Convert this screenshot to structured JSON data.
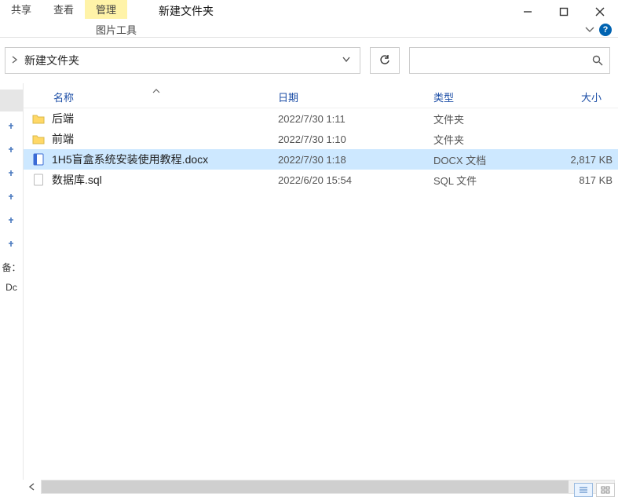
{
  "ribbon": {
    "tab_share": "共享",
    "tab_view": "查看",
    "tab_manage": "管理",
    "sub_image_tools": "图片工具"
  },
  "window": {
    "title": "新建文件夹"
  },
  "address": {
    "crumb": "新建文件夹"
  },
  "columns": {
    "name": "名称",
    "date": "日期",
    "type": "类型",
    "size": "大小"
  },
  "navpane": {
    "label_backup": "备：",
    "label_doc": "Dc"
  },
  "rows": [
    {
      "name": "后端",
      "date": "2022/7/30 1:11",
      "type": "文件夹",
      "size": "",
      "icon": "folder",
      "selected": false
    },
    {
      "name": "前端",
      "date": "2022/7/30 1:10",
      "type": "文件夹",
      "size": "",
      "icon": "folder",
      "selected": false
    },
    {
      "name": "1H5盲盒系统安装使用教程.docx",
      "date": "2022/7/30 1:18",
      "type": "DOCX 文档",
      "size": "2,817 KB",
      "icon": "docx",
      "selected": true
    },
    {
      "name": "数据库.sql",
      "date": "2022/6/20 15:54",
      "type": "SQL 文件",
      "size": "817 KB",
      "icon": "file",
      "selected": false
    }
  ]
}
